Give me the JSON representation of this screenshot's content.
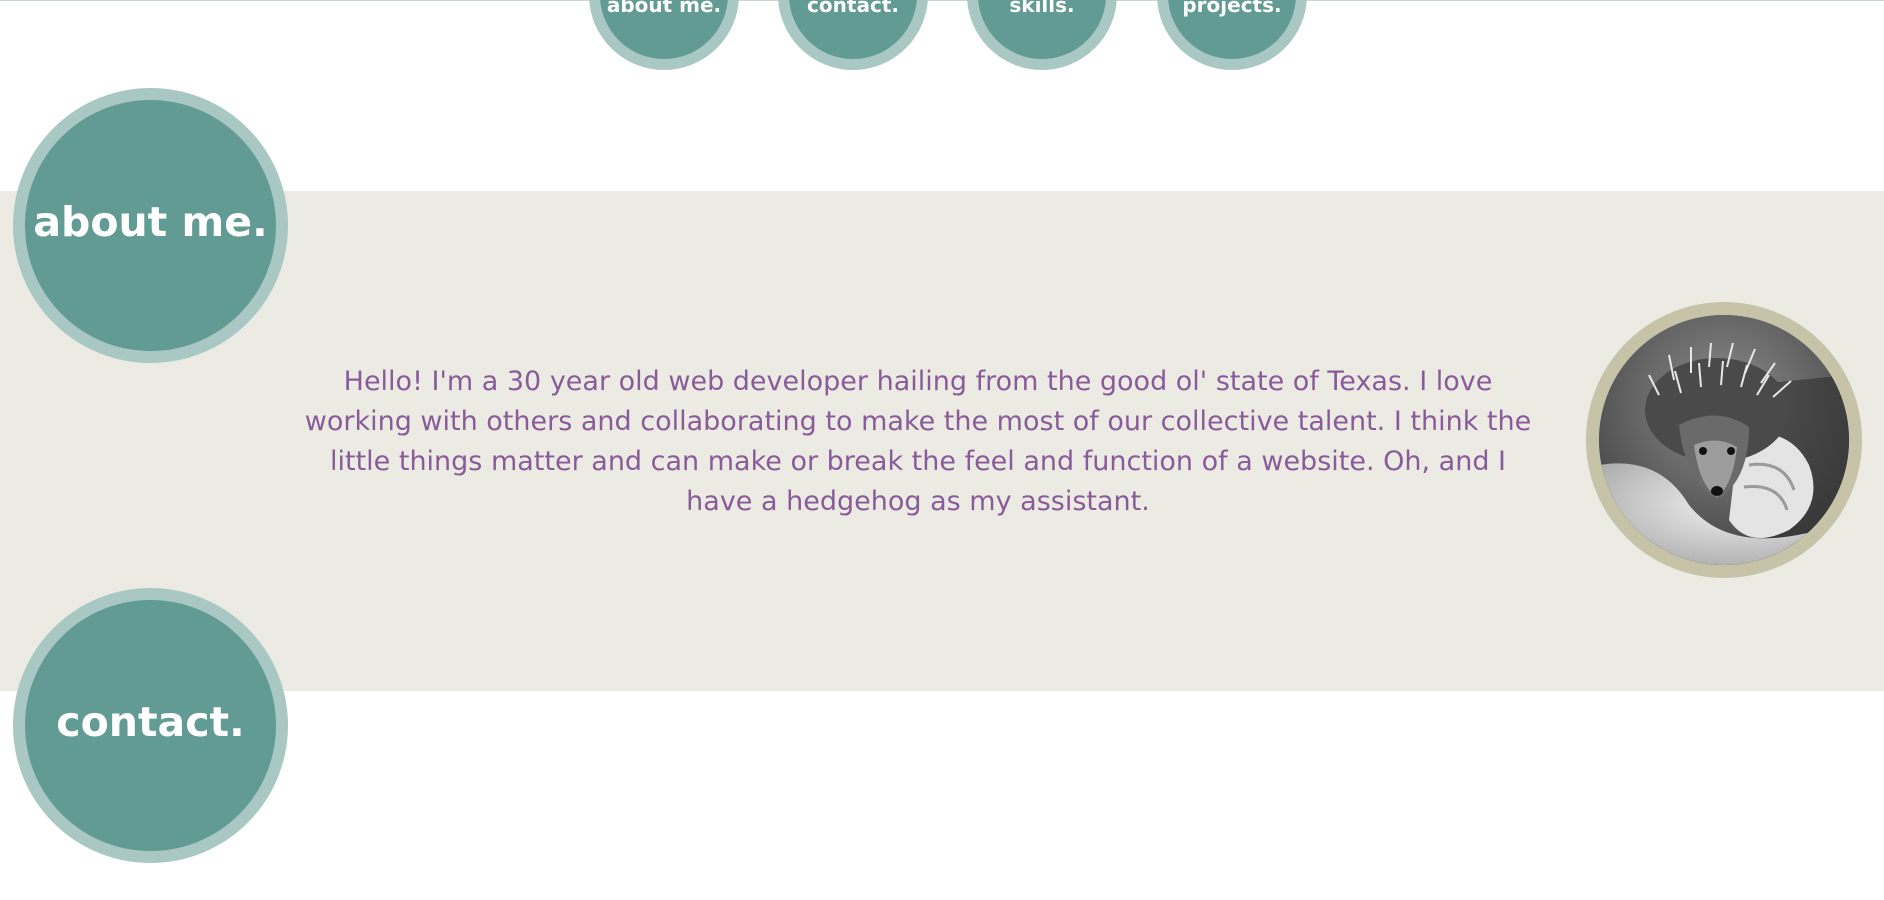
{
  "nav": {
    "items": [
      {
        "label": "about me."
      },
      {
        "label": "contact."
      },
      {
        "label": "skills."
      },
      {
        "label": "projects."
      }
    ]
  },
  "sections": {
    "about": {
      "title": "about me.",
      "text": "Hello! I'm a 30 year old web developer hailing from the good ol' state of Texas. I love working with others and collaborating to make the most of our collective talent. I think the little things matter and can make or break the feel and function of a website. Oh, and I have a hedgehog as my assistant."
    },
    "contact": {
      "title": "contact."
    }
  },
  "photo": {
    "icon": "hedgehog-photo"
  },
  "colors": {
    "circle_fill": "#619b93",
    "circle_ring": "#a9c8c3",
    "band_bg": "#ecebe3",
    "text_purple": "#8a5b9a",
    "photo_ring": "#c7c3a9"
  }
}
